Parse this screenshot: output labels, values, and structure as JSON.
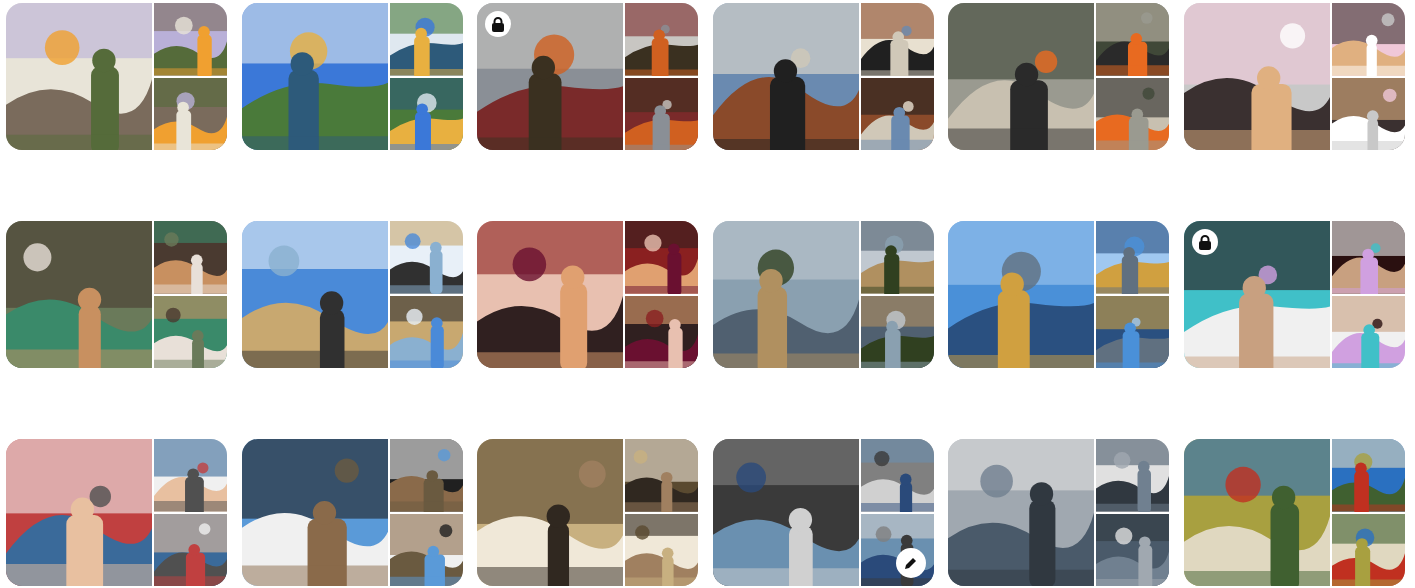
{
  "boards": [
    {
      "locked": false,
      "edit_button": false
    },
    {
      "locked": false,
      "edit_button": false
    },
    {
      "locked": true,
      "edit_button": false
    },
    {
      "locked": false,
      "edit_button": false
    },
    {
      "locked": false,
      "edit_button": false
    },
    {
      "locked": false,
      "edit_button": false
    },
    {
      "locked": false,
      "edit_button": false
    },
    {
      "locked": false,
      "edit_button": false
    },
    {
      "locked": false,
      "edit_button": false
    },
    {
      "locked": false,
      "edit_button": false
    },
    {
      "locked": false,
      "edit_button": false
    },
    {
      "locked": true,
      "edit_button": false
    },
    {
      "locked": false,
      "edit_button": false
    },
    {
      "locked": false,
      "edit_button": false
    },
    {
      "locked": false,
      "edit_button": false
    },
    {
      "locked": false,
      "edit_button": true
    },
    {
      "locked": false,
      "edit_button": false
    },
    {
      "locked": false,
      "edit_button": false
    }
  ]
}
